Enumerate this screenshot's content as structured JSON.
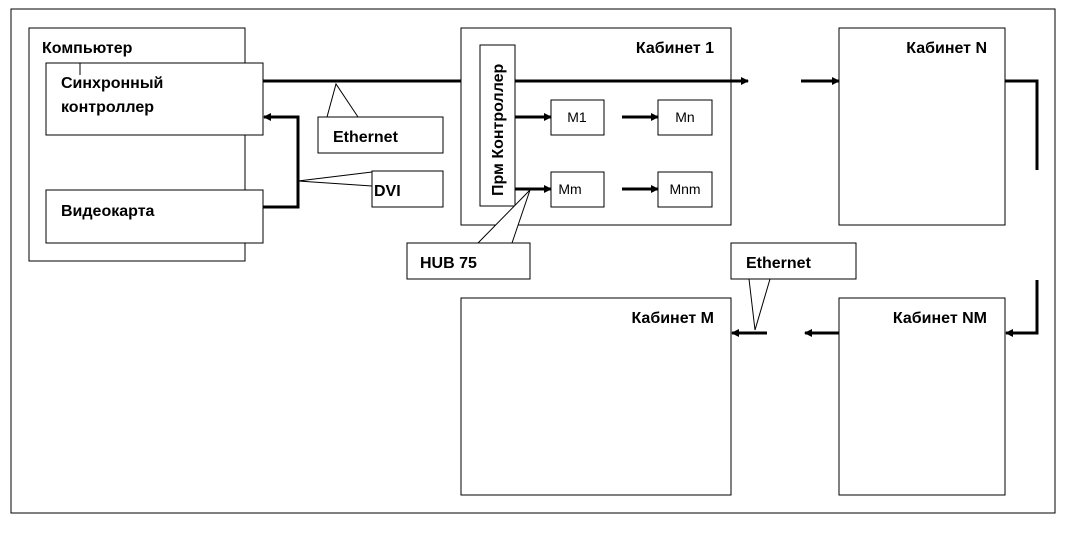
{
  "computer": {
    "title": "Компьютер",
    "sync_controller": [
      "Синхронный",
      "контроллер"
    ],
    "video_card": "Видеокарта"
  },
  "callouts": {
    "ethernet_top": "Ethernet",
    "dvi": "DVI",
    "hub": "HUB 75",
    "ethernet_bottom": "Ethernet"
  },
  "cabinet1": {
    "title": "Кабинет 1",
    "controller": "Прм Контроллер",
    "modules": [
      "M1",
      "Mn",
      "Mm",
      "Mnm"
    ]
  },
  "cabinetN": {
    "title": "Кабинет N"
  },
  "cabinetNM": {
    "title": "Кабинет NM"
  },
  "cabinetM": {
    "title": "Кабинет M"
  }
}
